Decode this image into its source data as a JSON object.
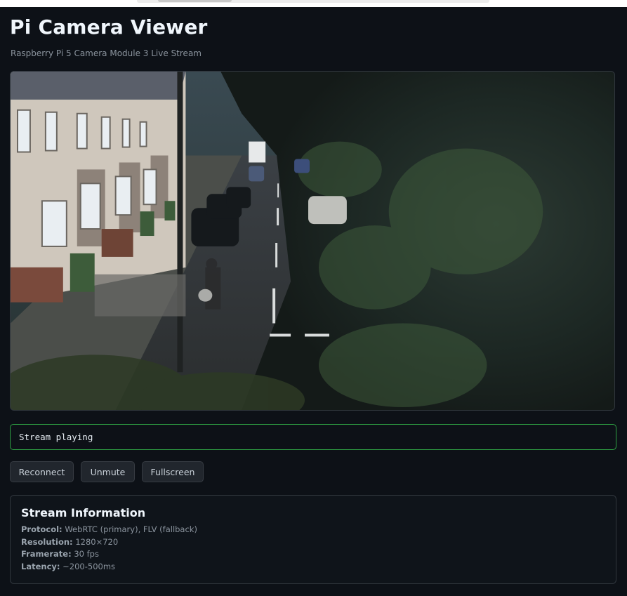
{
  "page": {
    "title": "Pi Camera Viewer",
    "subtitle": "Raspberry Pi 5 Camera Module 3 Live Stream"
  },
  "video": {
    "description_icon": "camera-feed-image"
  },
  "status": {
    "text": "Stream playing",
    "color": "#2ea043"
  },
  "controls": {
    "reconnect_label": "Reconnect",
    "unmute_label": "Unmute",
    "fullscreen_label": "Fullscreen"
  },
  "info": {
    "title": "Stream Information",
    "rows": [
      {
        "key": "Protocol:",
        "value": "WebRTC (primary), FLV (fallback)"
      },
      {
        "key": "Resolution:",
        "value": "1280×720"
      },
      {
        "key": "Framerate:",
        "value": "30 fps"
      },
      {
        "key": "Latency:",
        "value": "~200-500ms"
      }
    ]
  }
}
